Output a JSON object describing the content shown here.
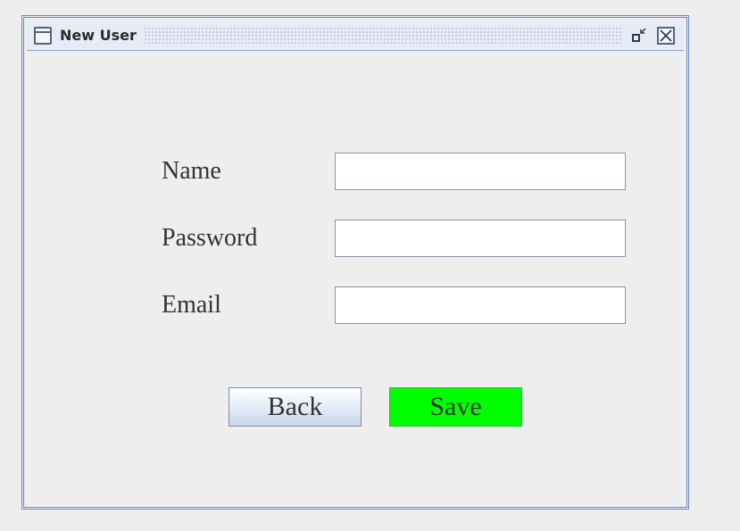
{
  "window": {
    "title": "New User",
    "icons": {
      "app": "window-icon",
      "restore": "restore-icon",
      "close": "close-icon"
    }
  },
  "form": {
    "name_label": "Name",
    "name_value": "",
    "password_label": "Password",
    "password_value": "",
    "email_label": "Email",
    "email_value": ""
  },
  "buttons": {
    "back_label": "Back",
    "save_label": "Save"
  },
  "colors": {
    "frame_border": "#6c86c6",
    "save_bg": "#00ff00",
    "background": "#eeeeee"
  }
}
